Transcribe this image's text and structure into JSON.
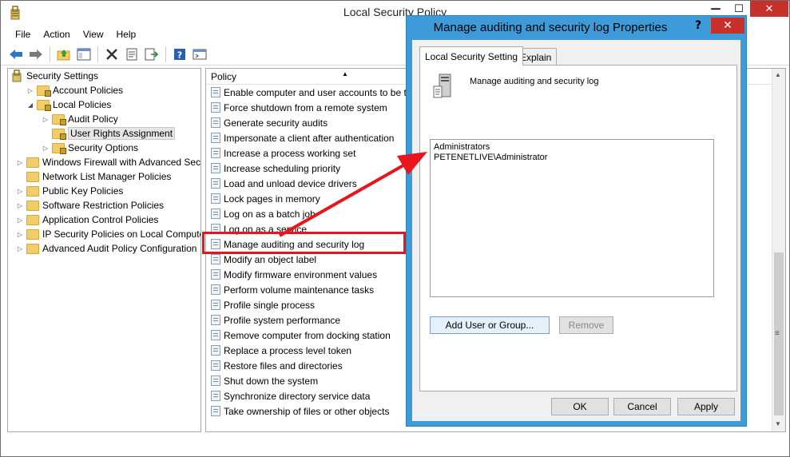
{
  "window": {
    "title": "Local Security Policy",
    "controls": {
      "minimize": "—",
      "maximize": "☐",
      "close": "✕"
    }
  },
  "menubar": [
    "File",
    "Action",
    "View",
    "Help"
  ],
  "toolbar": [
    "back-icon",
    "forward-icon",
    "up-folder-icon",
    "show-hide-tree-icon",
    "delete-icon",
    "properties-icon",
    "export-list-icon",
    "help-icon",
    "console-icon"
  ],
  "tree": {
    "root": "Security Settings",
    "nodes": [
      {
        "label": "Account Policies",
        "level": 1,
        "expander": "▷"
      },
      {
        "label": "Local Policies",
        "level": 1,
        "expander": "◢"
      },
      {
        "label": "Audit Policy",
        "level": 2,
        "expander": "▷"
      },
      {
        "label": "User Rights Assignment",
        "level": 2,
        "expander": "",
        "selected": true
      },
      {
        "label": "Security Options",
        "level": 2,
        "expander": "▷"
      },
      {
        "label": "Windows Firewall with Advanced Secu",
        "level": 0,
        "expander": "▷"
      },
      {
        "label": "Network List Manager Policies",
        "level": 0,
        "expander": ""
      },
      {
        "label": "Public Key Policies",
        "level": 0,
        "expander": "▷"
      },
      {
        "label": "Software Restriction Policies",
        "level": 0,
        "expander": "▷"
      },
      {
        "label": "Application Control Policies",
        "level": 0,
        "expander": "▷"
      },
      {
        "label": "IP Security Policies on Local Compute",
        "level": 0,
        "expander": "▷"
      },
      {
        "label": "Advanced Audit Policy Configuration",
        "level": 0,
        "expander": "▷"
      }
    ]
  },
  "list": {
    "column_header": "Policy",
    "rows": [
      "Enable computer and user accounts to be tr",
      "Force shutdown from a remote system",
      "Generate security audits",
      "Impersonate a client after authentication",
      "Increase a process working set",
      "Increase scheduling priority",
      "Load and unload device drivers",
      "Lock pages in memory",
      "Log on as a batch job",
      "Log on as a service",
      "Manage auditing and security log",
      "Modify an object label",
      "Modify firmware environment values",
      "Perform volume maintenance tasks",
      "Profile single process",
      "Profile system performance",
      "Remove computer from docking station",
      "Replace a process level token",
      "Restore files and directories",
      "Shut down the system",
      "Synchronize directory service data",
      "Take ownership of files or other objects"
    ],
    "highlighted_row": "Manage auditing and security log"
  },
  "dialog": {
    "title": "Manage auditing and security log Properties",
    "help": "?",
    "close": "✕",
    "tabs": [
      "Local Security Setting",
      "Explain"
    ],
    "policy_name": "Manage auditing and security log",
    "members": [
      "Administrators",
      "PETENETLIVE\\Administrator"
    ],
    "add_button": "Add User or Group...",
    "remove_button": "Remove",
    "ok": "OK",
    "cancel": "Cancel",
    "apply": "Apply"
  },
  "colors": {
    "accent": "#3c9bd8",
    "close": "#c7302b",
    "annotation": "#e8151c"
  }
}
